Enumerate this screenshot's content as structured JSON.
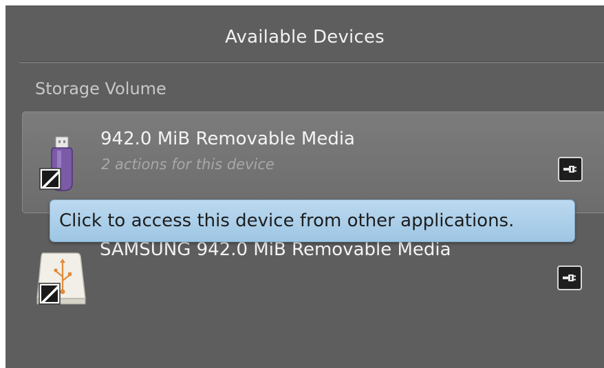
{
  "header": {
    "title": "Available Devices"
  },
  "section": {
    "label": "Storage Volume"
  },
  "devices": [
    {
      "name": "942.0 MiB Removable Media",
      "subtitle": "2 actions for this device",
      "icon": "usb-drive-icon",
      "selected": true
    },
    {
      "name": "SAMSUNG 942.0 MiB Removable Media",
      "subtitle": "",
      "icon": "removable-disk-icon",
      "selected": false
    }
  ],
  "tooltip": {
    "text": "Click to access this device from other applications."
  },
  "colors": {
    "panel_background": "#5e5e5e",
    "selected_row": "#737373",
    "tooltip_background": "#aed0ea",
    "text_primary": "#f4f4f4",
    "text_secondary": "#a8a8a8"
  }
}
